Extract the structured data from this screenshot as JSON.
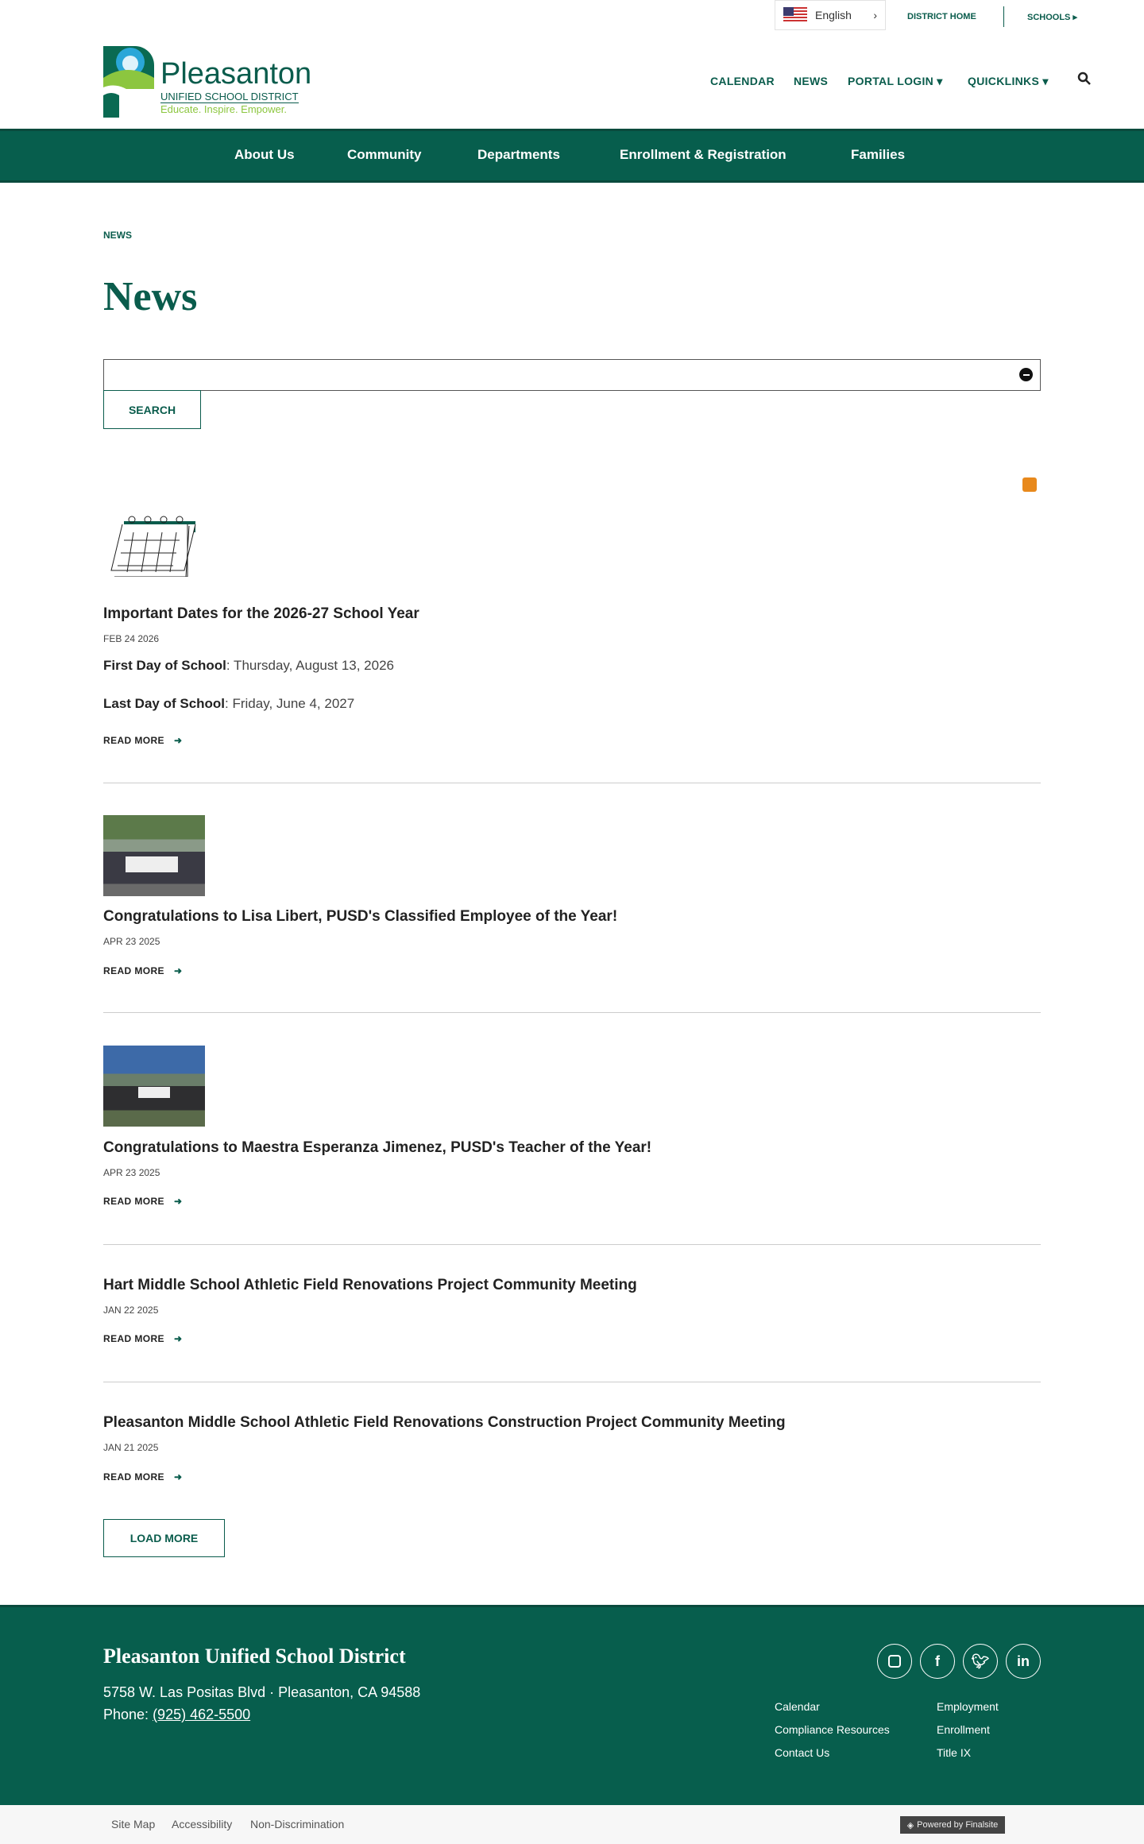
{
  "topbar": {
    "language": "English",
    "district_home": "DISTRICT HOME",
    "schools": "SCHOOLS"
  },
  "logo": {
    "name": "Pleasanton",
    "sub": "UNIFIED SCHOOL DISTRICT",
    "tagline": "Educate. Inspire. Empower."
  },
  "utility_nav": [
    "CALENDAR",
    "NEWS",
    "PORTAL LOGIN",
    "QUICKLINKS"
  ],
  "main_nav": [
    "About Us",
    "Community",
    "Departments",
    "Enrollment & Registration",
    "Families"
  ],
  "breadcrumb": "NEWS",
  "page_title": "News",
  "search": {
    "value": "",
    "button": "SEARCH"
  },
  "articles": [
    {
      "title": "Important Dates for the 2026-27 School Year",
      "date": "FEB 24 2026",
      "lines": [
        {
          "label": "First Day of School",
          "value": ": Thursday, August 13, 2026"
        },
        {
          "label": "Last Day of School",
          "value": ": Friday, June 4, 2027"
        }
      ],
      "read_more": "READ MORE"
    },
    {
      "title": "Congratulations to Lisa Libert, PUSD's Classified Employee of the Year!",
      "date": "APR 23 2025",
      "read_more": "READ MORE"
    },
    {
      "title": "Congratulations to Maestra Esperanza Jimenez, PUSD's Teacher of the Year!",
      "date": "APR 23 2025",
      "read_more": "READ MORE"
    },
    {
      "title": "Hart Middle School Athletic Field Renovations Project Community Meeting",
      "date": "JAN 22 2025",
      "read_more": "READ MORE"
    },
    {
      "title": "Pleasanton Middle School Athletic Field Renovations Construction Project Community Meeting",
      "date": "JAN 21 2025",
      "read_more": "READ MORE"
    }
  ],
  "load_more": "LOAD MORE",
  "footer": {
    "name": "Pleasanton Unified School District",
    "address": "5758 W. Las Positas Blvd · Pleasanton, CA  94588",
    "phone_label": "Phone: ",
    "phone": "(925) 462-5500",
    "links": [
      "Calendar",
      "Employment",
      "Compliance Resources",
      "Enrollment",
      "Contact Us",
      "Title IX"
    ]
  },
  "bottom": {
    "links": [
      "Site Map",
      "Accessibility",
      "Non-Discrimination"
    ],
    "powered": "Powered by Finalsite"
  },
  "colors": {
    "brand": "#075e4d",
    "accent": "#8cc63f"
  }
}
